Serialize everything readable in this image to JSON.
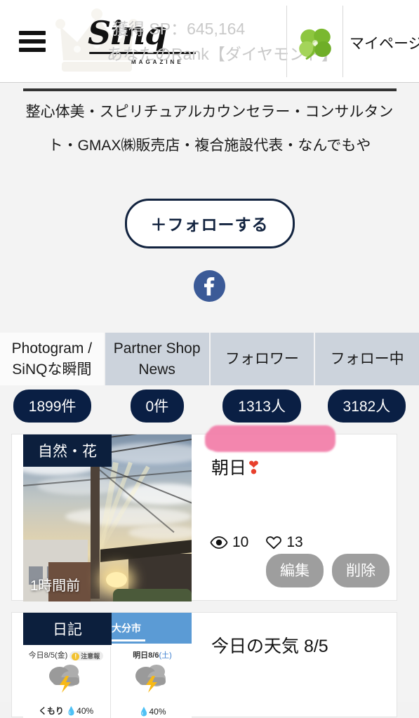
{
  "header": {
    "menu_icon": "hamburger-icon",
    "logo_text": "Sinq",
    "logo_sub": "MAGAZINE",
    "sp_label": "獲得 SP：645,164",
    "rank_label": "あなたのRank【ダイヤモンド】",
    "clover_icon": "clover-icon",
    "mypage_label": "マイページ"
  },
  "profile": {
    "bio": "整心体美・スピリチュアルカウンセラー・コンサルタント・GMAX㈱販売店・複合施設代表・なんでもや",
    "follow_button": "＋フォローする",
    "social": [
      {
        "name": "facebook",
        "glyph": "f",
        "color": "#3b5a97"
      }
    ]
  },
  "tabs": [
    {
      "label": "Photogram / SiNQな瞬間",
      "active": true,
      "count": "1899件"
    },
    {
      "label": "Partner Shop News",
      "active": false,
      "count": "0件"
    },
    {
      "label": "フォロワー",
      "active": false,
      "count": "1313人"
    },
    {
      "label": "フォロー中",
      "active": false,
      "count": "3182人"
    }
  ],
  "posts": [
    {
      "category": "自然・花",
      "time": "1時間前",
      "title": "朝日",
      "title_emoji": "❣",
      "views": "10",
      "likes": "13",
      "edit_label": "編集",
      "delete_label": "削除",
      "thumb_kind": "sunrise-photo"
    },
    {
      "category": "日記",
      "title": "今日の天気 8/5",
      "thumb_kind": "weather-widget",
      "weather": {
        "city": "大分市",
        "today": {
          "date": "今日8/5",
          "day": "(金)",
          "alert": "注意報",
          "desc": "くもり",
          "rain": "40",
          "unit": "%"
        },
        "tomorrow": {
          "date": "明日8/6",
          "day": "(土)",
          "desc": "",
          "rain": "40",
          "unit": "%"
        }
      }
    }
  ],
  "annotation": {
    "highlight_color": "#f27ca8"
  }
}
